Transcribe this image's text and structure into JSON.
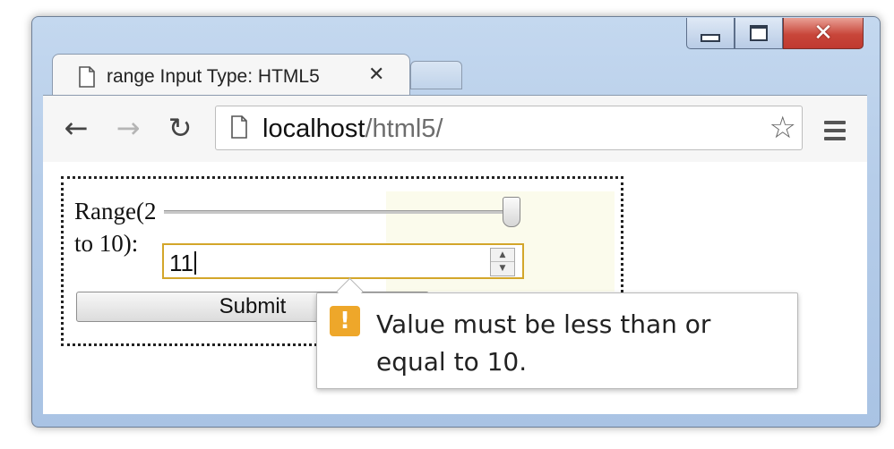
{
  "window": {
    "minimize": "—",
    "maximize": "□",
    "close": "✕"
  },
  "tab": {
    "title": "range Input Type: HTML5",
    "close": "✕"
  },
  "toolbar": {
    "back": "←",
    "forward": "→",
    "reload": "↻",
    "url_host": "localhost",
    "url_path": "/html5/",
    "star": "☆"
  },
  "form": {
    "range_label": "Range(2 to 10):",
    "range_value": 10,
    "range_min": 2,
    "range_max": 10,
    "number_value": "11",
    "spin_up": "▲",
    "spin_down": "▼",
    "submit_label": "Submit"
  },
  "validation": {
    "icon": "!",
    "message": "Value must be less than or equal to 10."
  },
  "colors": {
    "warning": "#eea72a",
    "input_focus_border": "#d3a62a",
    "close_button": "#c8463a"
  }
}
